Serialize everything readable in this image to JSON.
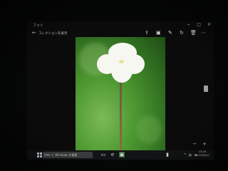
{
  "window": {
    "app_name": "フォト",
    "controls": {
      "minimize": "−",
      "maximize": "□",
      "close": "✕"
    }
  },
  "toolbar": {
    "back_icon": "back-arrow-icon",
    "collection_link": "コレクションを表示",
    "left_icons": [
      "share-icon",
      "slideshow-icon"
    ],
    "right_icons": [
      "edit-icon",
      "rotate-icon",
      "delete-icon",
      "more-icon"
    ]
  },
  "viewer": {
    "photo": "white-orchid-on-green-background",
    "zoom_minus": "−",
    "zoom_plus": "+"
  },
  "taskbar": {
    "search_placeholder": "Web と Windows を検索",
    "clock": {
      "time": "13:28",
      "date": "2015/08/07"
    },
    "accent": "#2c5e3a"
  }
}
